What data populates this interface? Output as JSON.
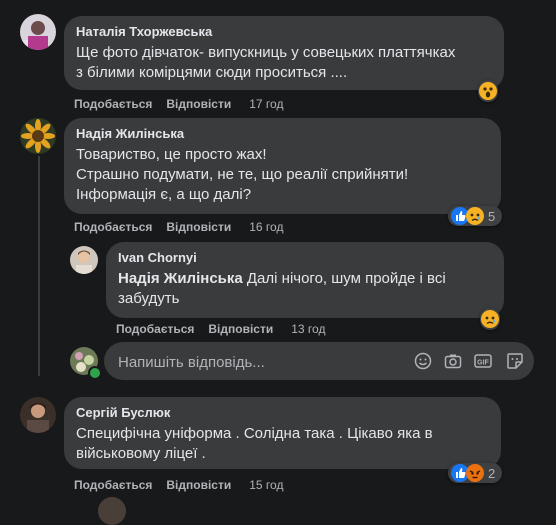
{
  "comments": [
    {
      "author": "Наталія Тхоржевська",
      "text": "Ще фото дівчаток- випускниць у совецьких платтячках\nз білими комірцями сюди проситься ....",
      "like_label": "Подобається",
      "reply_label": "Відповісти",
      "time": "17 год"
    },
    {
      "author": "Надія Жилінська",
      "text": "Товариство, це просто жах!\nСтрашно подумати, не те, що реалії сприйняти!\nІнформація є, а що далі?",
      "like_label": "Подобається",
      "reply_label": "Відповісти",
      "time": "16 год",
      "reaction_count": "5"
    },
    {
      "author": "Ivan Chornyi",
      "mention": "Надія Жилінська",
      "text": " Далі нічого, шум пройде і всі\nзабудуть",
      "like_label": "Подобається",
      "reply_label": "Відповісти",
      "time": "13 год"
    },
    {
      "author": "Сергій Буслюк",
      "text": "Специфічна уніформа . Солідна така . Цікаво яка в\nвійськовому ліцеї .",
      "like_label": "Подобається",
      "reply_label": "Відповісти",
      "time": "15 год",
      "reaction_count": "2"
    }
  ],
  "reply_input": {
    "placeholder": "Напишіть відповідь..."
  },
  "reply_tools": [
    "emoji-icon",
    "camera-icon",
    "gif-icon",
    "sticker-icon"
  ],
  "colors": {
    "background": "#18191a",
    "bubble": "#3a3b3c",
    "text": "#e4e6eb",
    "secondary": "#b0b3b8",
    "like_blue": "#1877f2",
    "angry_red": "#e9710f"
  }
}
